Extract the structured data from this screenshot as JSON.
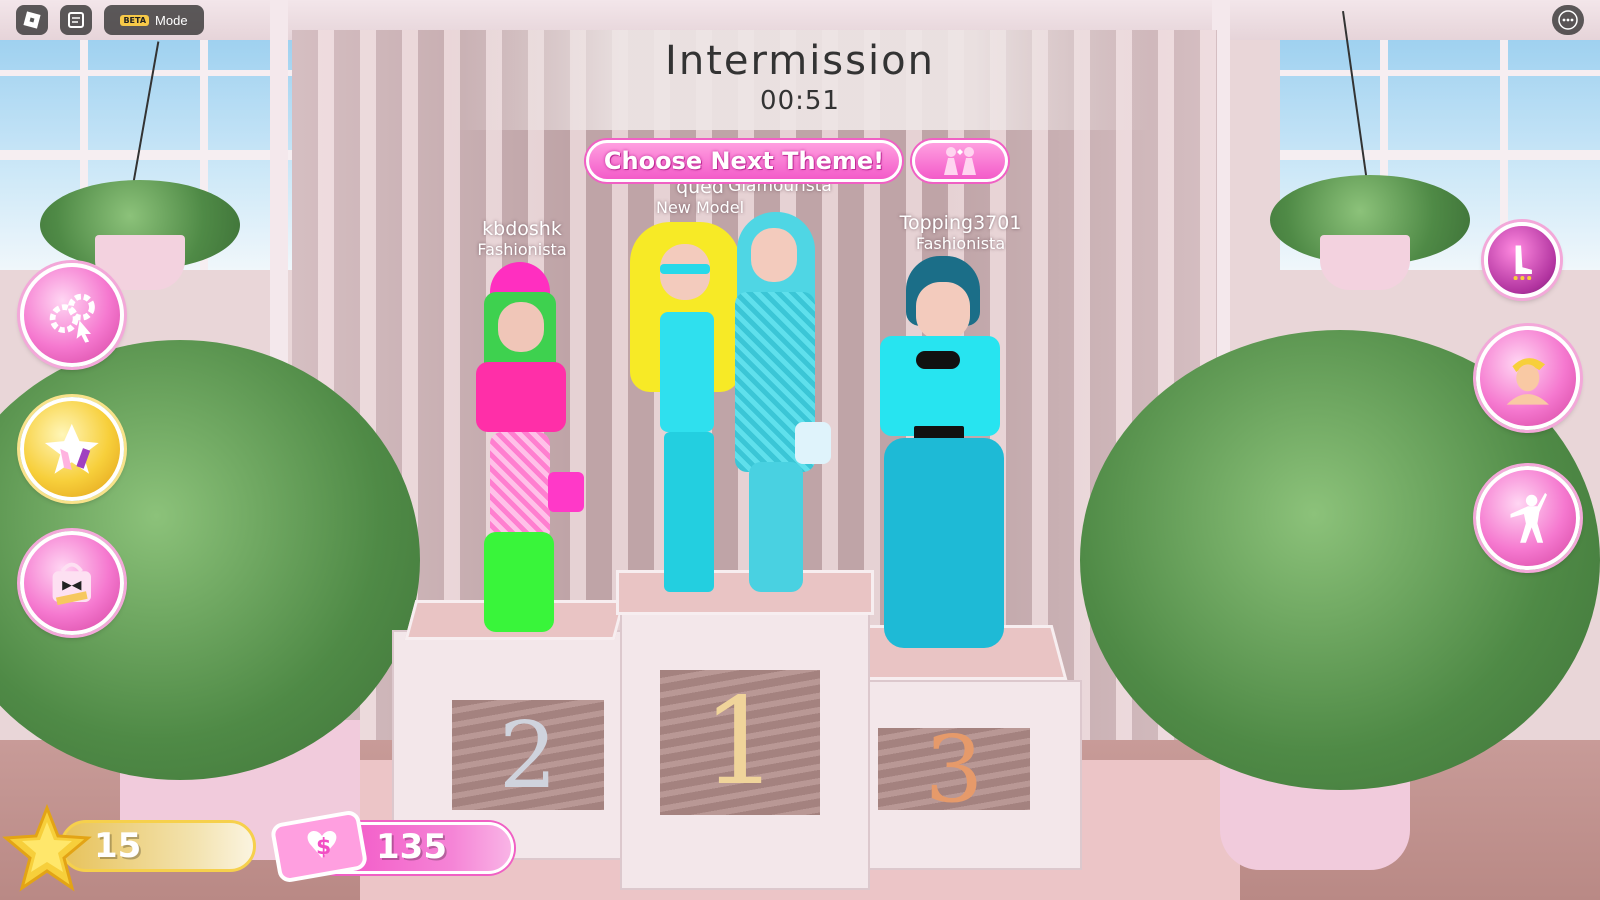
{
  "topbar": {
    "roblox_menu_icon": "roblox-logo-icon",
    "chat_icon": "chat-icon",
    "beta_badge": "BETA",
    "mode_label": "Mode",
    "more_icon": "more-icon"
  },
  "round": {
    "title": "Intermission",
    "timer": "00:51"
  },
  "actions": {
    "choose_theme_label": "Choose Next Theme!",
    "duo_icon": "duo-models-icon"
  },
  "players": [
    {
      "name": "kbdoshk",
      "rank": "Fashionista",
      "podium": "2"
    },
    {
      "name": "qued",
      "rank": "New Model",
      "podium": "1"
    },
    {
      "name": "Glamourista",
      "rank": "",
      "podium": "1"
    },
    {
      "name": "Topping3701",
      "rank": "Fashionista",
      "podium": "3"
    }
  ],
  "podium_numbers": [
    "2",
    "1",
    "3"
  ],
  "left_menu": [
    "settings-icon",
    "style-shop-icon",
    "codes-icon"
  ],
  "right_menu": [
    "heels-icon",
    "avatar-icon",
    "pose-icon"
  ],
  "stats": {
    "level": "15",
    "money": "135"
  },
  "colors": {
    "accent_pink": "#f35bc9",
    "gold": "#f7cf3b"
  }
}
